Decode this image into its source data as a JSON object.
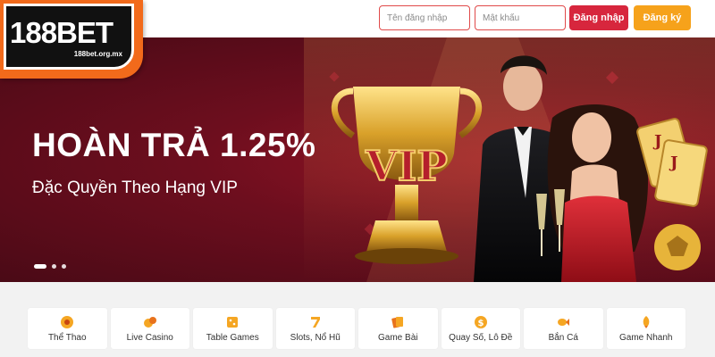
{
  "brand": {
    "logo_text": "188BET",
    "logo_url_text": "188bet.org.mx",
    "accent": "#f26a1b"
  },
  "login": {
    "username_placeholder": "Tên đăng nhập",
    "password_placeholder": "Mật khẩu",
    "login_label": "Đăng nhập",
    "register_label": "Đăng ký",
    "login_color": "#d7263d",
    "register_color": "#f6a21b"
  },
  "banner": {
    "headline": "HOÀN TRẢ 1.25%",
    "subline": "Đặc Quyền Theo Hạng VIP",
    "trophy_text": "VIP",
    "card_letters": [
      "J",
      "J"
    ],
    "slides_total": 3,
    "slide_active": 1
  },
  "categories": [
    {
      "label": "Thể Thao",
      "icon": "soccer-ball-icon"
    },
    {
      "label": "Live Casino",
      "icon": "chips-icon"
    },
    {
      "label": "Table Games",
      "icon": "dice-icon"
    },
    {
      "label": "Slots, Nổ Hũ",
      "icon": "slot-seven-icon"
    },
    {
      "label": "Game Bài",
      "icon": "cards-icon"
    },
    {
      "label": "Quay Số, Lô Đề",
      "icon": "lottery-icon"
    },
    {
      "label": "Bắn Cá",
      "icon": "fish-icon"
    },
    {
      "label": "Game Nhanh",
      "icon": "rocket-icon"
    }
  ]
}
